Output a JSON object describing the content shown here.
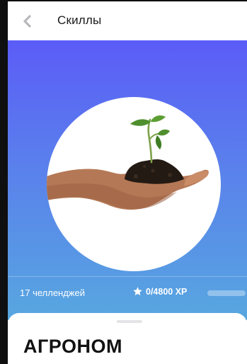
{
  "header": {
    "title": "Скиллы",
    "back_icon": "chevron-left-icon"
  },
  "hero": {
    "image": "hand-holding-seedling",
    "gradient_top": "#5b5cf7",
    "gradient_bottom": "#57a7e0"
  },
  "stats": {
    "challenges": "17 челленджей",
    "xp": "0/4800 XP",
    "xp_progress": 0
  },
  "sheet": {
    "skill_name": "АГРОНОМ"
  }
}
